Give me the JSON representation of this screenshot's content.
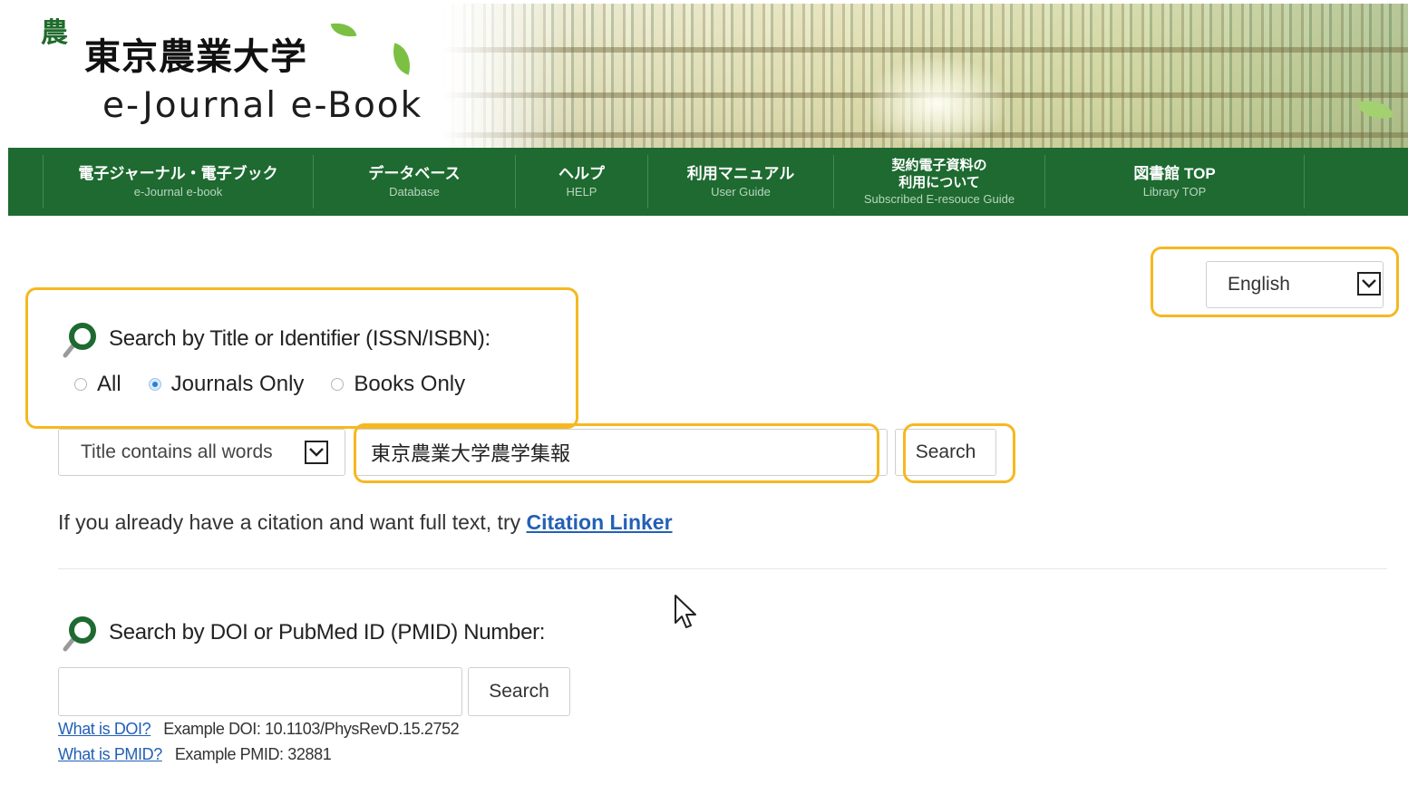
{
  "header": {
    "logo_mark": "農",
    "university_name": "東京農業大学",
    "site_title": "e-Journal e-Book"
  },
  "nav": {
    "items": [
      {
        "jp": "電子ジャーナル・電子ブック",
        "en": "e-Journal e-book"
      },
      {
        "jp": "データベース",
        "en": "Database"
      },
      {
        "jp": "ヘルプ",
        "en": "HELP"
      },
      {
        "jp": "利用マニュアル",
        "en": "User Guide"
      },
      {
        "jp_line1": "契約電子資料の",
        "jp_line2": "利用について",
        "en": "Subscribed E-resouce Guide"
      },
      {
        "jp": "図書館 TOP",
        "en": "Library TOP"
      }
    ]
  },
  "language": {
    "selected": "English"
  },
  "title_search": {
    "heading": "Search by Title or Identifier (ISSN/ISBN):",
    "radio_options": [
      "All",
      "Journals Only",
      "Books Only"
    ],
    "radio_selected": "Journals Only",
    "match_type": "Title contains all words",
    "query": "東京農業大学農学集報",
    "search_button": "Search"
  },
  "citation": {
    "text": "If you already have a citation and want full text, try ",
    "link": "Citation Linker"
  },
  "doi_search": {
    "heading": "Search by DOI or PubMed ID (PMID) Number:",
    "value": "",
    "search_button": "Search",
    "doi_help_link": "What is DOI?",
    "doi_example": "Example DOI: 10.1103/PhysRevD.15.2752",
    "pmid_help_link": "What is PMID?",
    "pmid_example": "Example PMID: 32881"
  },
  "colors": {
    "nav_background": "#1e6a31",
    "highlight": "#f5b820",
    "link": "#2360b6",
    "leaf": "#7cc043"
  }
}
